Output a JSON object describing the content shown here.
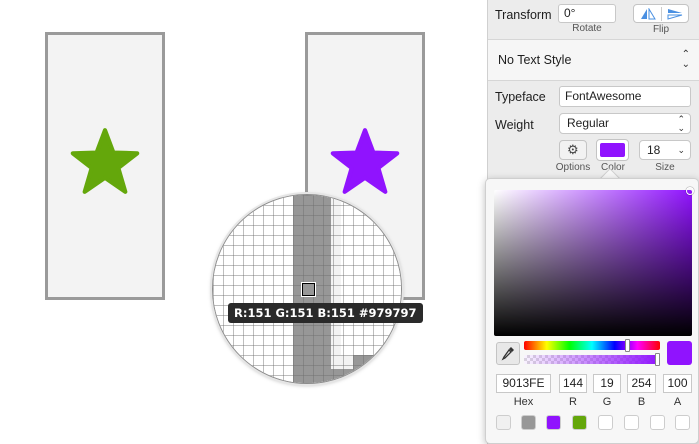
{
  "canvas": {
    "star_left_color": "#64a70b",
    "star_right_color": "#9013fe",
    "artboard_border_color": "#9a9a9a"
  },
  "magnifier": {
    "readout": "R:151 G:151 B:151 #979797",
    "sampled_color": "#979797"
  },
  "inspector": {
    "transform": {
      "label": "Transform",
      "rotate_value": "0°",
      "rotate_label": "Rotate",
      "flip_label": "Flip"
    },
    "text_style": {
      "value": "No Text Style"
    },
    "typeface": {
      "label": "Typeface",
      "value": "FontAwesome"
    },
    "weight": {
      "label": "Weight",
      "value": "Regular"
    },
    "options_label": "Options",
    "color_label": "Color",
    "color_value": "#9013fe",
    "size": {
      "label": "Size",
      "value": "18"
    }
  },
  "color_picker": {
    "hex_value": "9013FE",
    "hex_label": "Hex",
    "r_value": "144",
    "r_label": "R",
    "g_value": "19",
    "g_label": "G",
    "b_value": "254",
    "b_label": "B",
    "a_value": "100",
    "a_label": "A",
    "current_color": "#9013fe",
    "document_swatches": [
      "#f0f0f0",
      "#979797",
      "#9013fe",
      "#64a70b",
      "#ffffff",
      "#ffffff",
      "#ffffff",
      "#ffffff"
    ]
  }
}
